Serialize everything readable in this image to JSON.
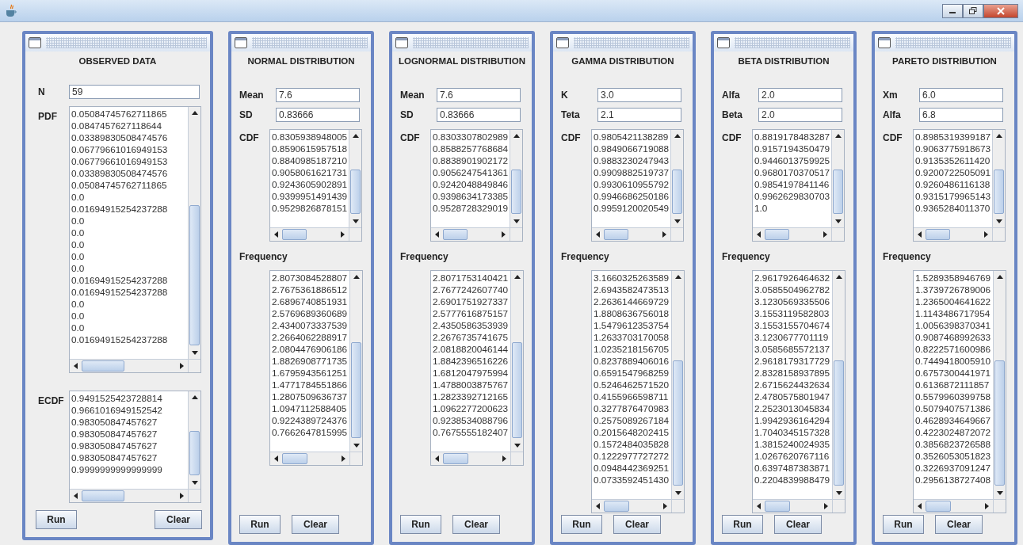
{
  "panels": [
    {
      "kind": "observed",
      "title": "OBSERVED DATA",
      "fields": [
        {
          "label": "N",
          "value": "59"
        }
      ],
      "lists": [
        {
          "label": "PDF",
          "kind": "inline",
          "items": [
            "0.05084745762711865",
            "0.0847457627118644",
            "0.03389830508474576",
            "0.06779661016949153",
            "0.06779661016949153",
            "0.03389830508474576",
            "0.05084745762711865",
            "0.0",
            "0.01694915254237288",
            "0.0",
            "0.0",
            "0.0",
            "0.0",
            "0.0",
            "0.01694915254237288",
            "0.01694915254237288",
            "0.0",
            "0.0",
            "0.0",
            "0.01694915254237288"
          ]
        },
        {
          "label": "ECDF",
          "kind": "inline",
          "items": [
            "0.9491525423728814",
            "0.9661016949152542",
            "0.983050847457627",
            "0.983050847457627",
            "0.983050847457627",
            "0.983050847457627",
            "0.9999999999999999"
          ]
        }
      ],
      "buttons": [
        "Run",
        "Clear"
      ]
    },
    {
      "kind": "distribution",
      "title": "NORMAL DISTRIBUTION",
      "fields": [
        {
          "label": "Mean",
          "value": "7.6"
        },
        {
          "label": "SD",
          "value": "0.83666"
        }
      ],
      "lists": [
        {
          "label": "CDF",
          "kind": "inline",
          "items": [
            "0.8305938948005",
            "0.8590615957518",
            "0.8840985187210",
            "0.9058061621731",
            "0.9243605902891",
            "0.9399951491439",
            "0.9529826878151"
          ]
        },
        {
          "label": "Frequency",
          "kind": "stacked",
          "items": [
            "2.8073084528807",
            "2.7675361886512",
            "2.6896740851931",
            "2.5769689360689",
            "2.4340073337539",
            "2.2664062288917",
            "2.0804476906186",
            "1.8826908771735",
            "1.6795943561251",
            "1.4771784551866",
            "1.2807509636737",
            "1.0947112588405",
            "0.9224389724376",
            "0.7662647815995"
          ]
        }
      ],
      "buttons": [
        "Run",
        "Clear"
      ]
    },
    {
      "kind": "distribution",
      "title": "LOGNORMAL DISTRIBUTION",
      "fields": [
        {
          "label": "Mean",
          "value": "7.6"
        },
        {
          "label": "SD",
          "value": "0.83666"
        }
      ],
      "lists": [
        {
          "label": "CDF",
          "kind": "inline",
          "items": [
            "0.8303307802989",
            "0.8588257768684",
            "0.8838901902172",
            "0.9056247541361",
            "0.9242048849846",
            "0.9398634173385",
            "0.9528728329019"
          ]
        },
        {
          "label": "Frequency",
          "kind": "stacked",
          "items": [
            "2.8071753140421",
            "2.7677242607740",
            "2.6901751927337",
            "2.5777616875157",
            "2.4350586353939",
            "2.2676735741675",
            "2.0818820046144",
            "1.8842396516226",
            "1.6812047975994",
            "1.4788003875767",
            "1.2823392712165",
            "1.0962277200623",
            "0.9238534088796",
            "0.7675555182407"
          ]
        }
      ],
      "buttons": [
        "Run",
        "Clear"
      ]
    },
    {
      "kind": "distribution",
      "title": "GAMMA DISTRIBUTION",
      "fields": [
        {
          "label": "K",
          "value": "3.0"
        },
        {
          "label": "Teta",
          "value": "2.1"
        }
      ],
      "lists": [
        {
          "label": "CDF",
          "kind": "inline",
          "items": [
            "0.9805421138289",
            "0.9849066719088",
            "0.9883230247943",
            "0.9909882519737",
            "0.9930610955792",
            "0.9946686250186",
            "0.9959120020549"
          ]
        },
        {
          "label": "Frequency",
          "kind": "stacked",
          "items": [
            "3.1660325263589",
            "2.6943582473513",
            "2.2636144669729",
            "1.8808636756018",
            "1.5479612353754",
            "1.2633703170058",
            "1.0235218156705",
            "0.8237889406016",
            "0.6591547968259",
            "0.5246462571520",
            "0.4155966598711",
            "0.3277876470983",
            "0.2575089267184",
            "0.2015648202415",
            "0.1572484035828",
            "0.1222977727272",
            "0.0948442369251",
            "0.0733592451430"
          ]
        }
      ],
      "buttons": [
        "Run",
        "Clear"
      ]
    },
    {
      "kind": "distribution",
      "title": "BETA DISTRIBUTION",
      "fields": [
        {
          "label": "Alfa",
          "value": "2.0"
        },
        {
          "label": "Beta",
          "value": "2.0"
        }
      ],
      "lists": [
        {
          "label": "CDF",
          "kind": "inline",
          "items": [
            "0.8819178483287",
            "0.9157194350479",
            "0.9446013759925",
            "0.9680170370517",
            "0.9854197841146",
            "0.9962629830703",
            "1.0"
          ]
        },
        {
          "label": "Frequency",
          "kind": "stacked",
          "items": [
            "2.9617926464632",
            "3.0585504962782",
            "3.1230569335506",
            "3.1553119582803",
            "3.1553155704674",
            "3.1230677701119",
            "3.0585685572137",
            "2.9618179317729",
            "2.8328158937895",
            "2.6715624432634",
            "2.4780575801947",
            "2.2523013045834",
            "1.9942936164294",
            "1.7040345157328",
            "1.3815240024935",
            "1.0267620767116",
            "0.6397487383871",
            "0.2204839988479"
          ]
        }
      ],
      "buttons": [
        "Run",
        "Clear"
      ]
    },
    {
      "kind": "distribution",
      "title": "PARETO DISTRIBUTION",
      "fields": [
        {
          "label": "Xm",
          "value": "6.0"
        },
        {
          "label": "Alfa",
          "value": "6.8"
        }
      ],
      "lists": [
        {
          "label": "CDF",
          "kind": "inline",
          "items": [
            "0.8985319399187",
            "0.9063775918673",
            "0.9135352611420",
            "0.9200722505091",
            "0.9260486116138",
            "0.9315179965143",
            "0.9365284011370"
          ]
        },
        {
          "label": "Frequency",
          "kind": "stacked",
          "items": [
            "1.5289358946769",
            "1.3739726789006",
            "1.2365004641622",
            "1.1143486717954",
            "1.0056398370341",
            "0.9087468992633",
            "0.8222571600986",
            "0.7449418005910",
            "0.6757300441971",
            "0.6136872111857",
            "0.5579960399758",
            "0.5079407571386",
            "0.4628934649667",
            "0.4223024872072",
            "0.3856823726588",
            "0.3526053051823",
            "0.3226937091247",
            "0.2956138727408"
          ]
        }
      ],
      "buttons": [
        "Run",
        "Clear"
      ]
    }
  ]
}
